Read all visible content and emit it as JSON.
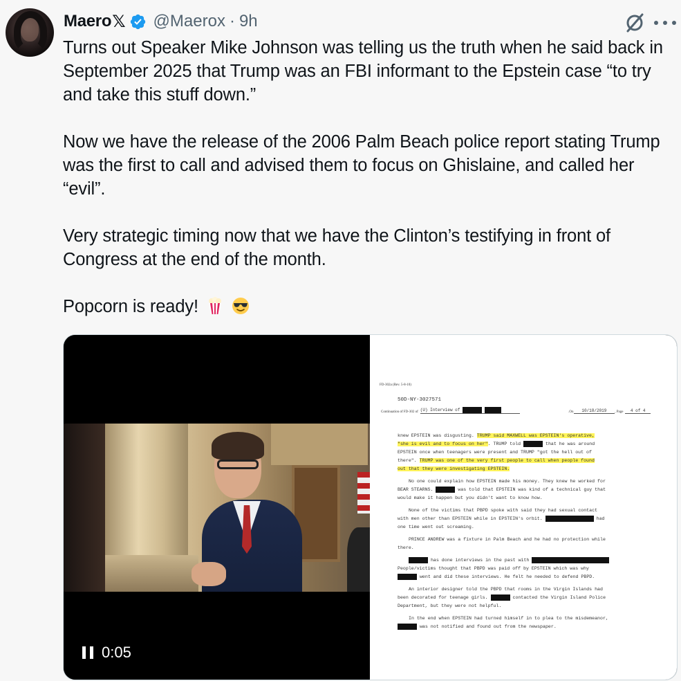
{
  "tweet": {
    "author_name": "Maero",
    "author_suffix": "𝕏",
    "handle": "@Maerox",
    "separator": "·",
    "time": "9h",
    "paragraphs": [
      "Turns out Speaker Mike Johnson was telling us the truth when he said back in September 2025 that Trump was an FBI informant to the Epstein case “to try and take this stuff down.”",
      "Now we have the release of the 2006 Palm Beach police report stating Trump was the first to call and advised them to focus on Ghislaine, and called her “evil”.",
      "Very strategic timing now that we have the Clinton’s testifying in front of Congress at the end of the month.",
      "Popcorn is ready!"
    ],
    "emojis": [
      "popcorn-icon",
      "sunglasses-face-icon"
    ],
    "verified_color": "#1d9bf0"
  },
  "video": {
    "duration": "0:05",
    "state": "playing"
  },
  "document": {
    "form_id": "FD-302a (Rev. 5-8-10)",
    "case_no": "50D-NY-3027571",
    "cont_label": "Continuation of FD-302 of",
    "cont_subject": "(U) Interview of",
    "on_label": ".On",
    "date": "10/18/2019",
    "page_label": ", Page",
    "page": "4 of 4",
    "lines": [
      {
        "pre": "knew EPSTEIN was disgusting.  ",
        "hl": "TRUMP said MAXWELL was EPSTEIN's operative,"
      },
      {
        "hl": "\"she is evil and to focus on her\"",
        "post": ".  TRUMP told ████ that he was around"
      },
      {
        "pre": "EPSTEIN once when teenagers were present and TRUMP \"got the hell out of"
      },
      {
        "pre": "there\".  ",
        "hl": "TRUMP was one of the very first people to call when people found"
      },
      {
        "hl": "out that they were investigating EPSTEIN."
      },
      {
        "gap": true
      },
      {
        "ind": true,
        "pre": "No one could explain how EPSTEIN made his money.  They knew he worked for"
      },
      {
        "pre": "BEAR STEARNS.  ████ was told that EPSTEIN was kind of a technical guy that"
      },
      {
        "pre": "would make it happen but you didn't want to know how."
      },
      {
        "gap": true
      },
      {
        "ind": true,
        "pre": "None of the victims that PBPD spoke with said they had sexual contact"
      },
      {
        "pre": "with men other than EPSTEIN while in EPSTEIN's orbit.  ██████████ had"
      },
      {
        "pre": "one time went out screaming."
      },
      {
        "gap": true
      },
      {
        "ind": true,
        "pre": "PRINCE ANDREW was a fixture in Palm Beach and he had no protection while"
      },
      {
        "pre": "there."
      },
      {
        "gap": true
      },
      {
        "ind": true,
        "pre": "████ has done interviews in the past with ████████████████"
      },
      {
        "pre": "People/victims thought that PBPD was paid off by EPSTEIN which was why"
      },
      {
        "pre": "████ went and did these interviews.  He felt he needed to defend PBPD."
      },
      {
        "gap": true
      },
      {
        "ind": true,
        "pre": "An interior designer told the PBPD that rooms in the Virgin Islands had"
      },
      {
        "pre": "been decorated for teenage girls.  ████ contacted the Virgin Island Police"
      },
      {
        "pre": "Department, but they were not helpful."
      },
      {
        "gap": true
      },
      {
        "ind": true,
        "pre": "In the end when EPSTEIN had turned himself in to plea to the misdemeanor,"
      },
      {
        "pre": "████ was not notified and found out from the newspaper."
      }
    ]
  }
}
